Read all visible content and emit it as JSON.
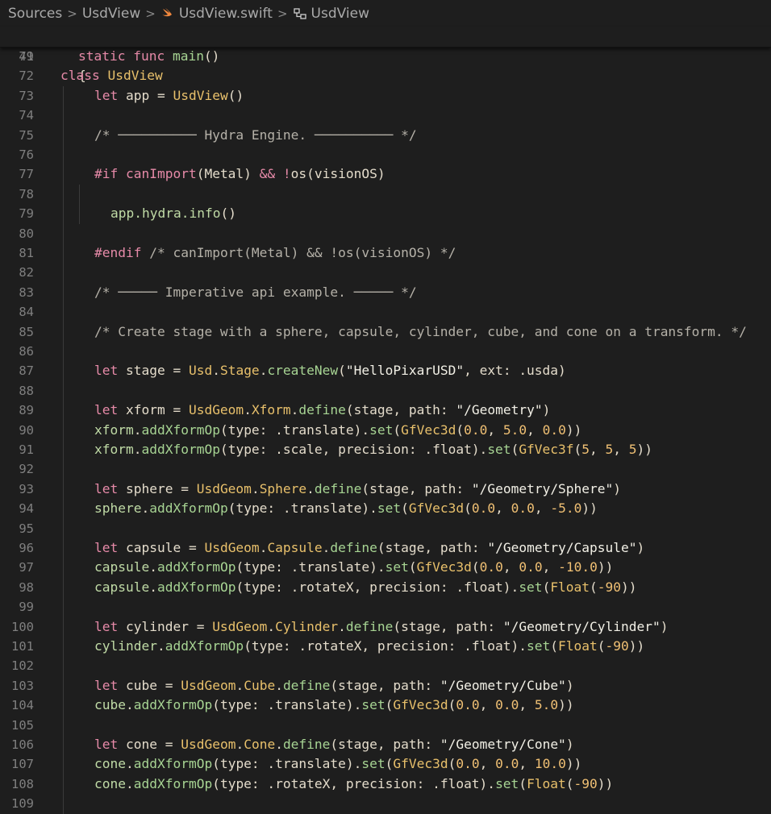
{
  "breadcrumb": {
    "items": [
      "Sources",
      "UsdView",
      "UsdView.swift",
      "UsdView"
    ]
  },
  "sticky": {
    "line_number": "49",
    "code": [
      [
        "kw",
        "class "
      ],
      [
        "ty",
        "UsdView"
      ]
    ]
  },
  "lines": [
    {
      "n": "71",
      "indent": 1,
      "tokens": [
        [
          "kw",
          "static func "
        ],
        [
          "fn",
          "main"
        ],
        [
          "pl",
          "()"
        ]
      ]
    },
    {
      "n": "72",
      "indent": 1,
      "tokens": [
        [
          "pl",
          "{"
        ]
      ]
    },
    {
      "n": "73",
      "indent": 2,
      "tokens": [
        [
          "kw",
          "let "
        ],
        [
          "pl",
          "app = "
        ],
        [
          "ty",
          "UsdView"
        ],
        [
          "pl",
          "()"
        ]
      ]
    },
    {
      "n": "74",
      "indent": 2,
      "tokens": []
    },
    {
      "n": "75",
      "indent": 2,
      "tokens": [
        [
          "cm",
          "/* ────────── Hydra Engine. ────────── */"
        ]
      ]
    },
    {
      "n": "76",
      "indent": 2,
      "tokens": []
    },
    {
      "n": "77",
      "indent": 2,
      "tokens": [
        [
          "pp",
          "#if "
        ],
        [
          "pp",
          "canImport"
        ],
        [
          "pl",
          "(Metal) "
        ],
        [
          "kw",
          "&& !"
        ],
        [
          "pl",
          "os(visionOS)"
        ]
      ]
    },
    {
      "n": "78",
      "indent": 3,
      "tokens": []
    },
    {
      "n": "79",
      "indent": 3,
      "tokens": [
        [
          "ac",
          "app.hydra.info"
        ],
        [
          "pl",
          "()"
        ]
      ]
    },
    {
      "n": "80",
      "indent": 2,
      "tokens": []
    },
    {
      "n": "81",
      "indent": 2,
      "tokens": [
        [
          "pp",
          "#endif "
        ],
        [
          "cm",
          "/* canImport(Metal) && !os(visionOS) */"
        ]
      ]
    },
    {
      "n": "82",
      "indent": 2,
      "tokens": []
    },
    {
      "n": "83",
      "indent": 2,
      "tokens": [
        [
          "cm",
          "/* ───── Imperative api example. ───── */"
        ]
      ]
    },
    {
      "n": "84",
      "indent": 2,
      "tokens": []
    },
    {
      "n": "85",
      "indent": 2,
      "tokens": [
        [
          "cm",
          "/* Create stage with a sphere, capsule, cylinder, cube, and cone on a transform. */"
        ]
      ]
    },
    {
      "n": "86",
      "indent": 2,
      "tokens": []
    },
    {
      "n": "87",
      "indent": 2,
      "tokens": [
        [
          "kw",
          "let "
        ],
        [
          "pl",
          "stage = "
        ],
        [
          "ty",
          "Usd"
        ],
        [
          "pl",
          "."
        ],
        [
          "ty",
          "Stage"
        ],
        [
          "pl",
          "."
        ],
        [
          "fn",
          "createNew"
        ],
        [
          "pl",
          "("
        ],
        [
          "str",
          "\"HelloPixarUSD\""
        ],
        [
          "pl",
          ", ext: .usda)"
        ]
      ]
    },
    {
      "n": "88",
      "indent": 2,
      "tokens": []
    },
    {
      "n": "89",
      "indent": 2,
      "tokens": [
        [
          "kw",
          "let "
        ],
        [
          "pl",
          "xform = "
        ],
        [
          "ty",
          "UsdGeom"
        ],
        [
          "pl",
          "."
        ],
        [
          "ty",
          "Xform"
        ],
        [
          "pl",
          "."
        ],
        [
          "fn",
          "define"
        ],
        [
          "pl",
          "(stage, path: "
        ],
        [
          "str",
          "\"/Geometry\""
        ],
        [
          "pl",
          ")"
        ]
      ]
    },
    {
      "n": "90",
      "indent": 2,
      "tokens": [
        [
          "ac",
          "xform"
        ],
        [
          "pl",
          "."
        ],
        [
          "fn",
          "addXformOp"
        ],
        [
          "pl",
          "(type: .translate)."
        ],
        [
          "fn",
          "set"
        ],
        [
          "pl",
          "("
        ],
        [
          "ty",
          "GfVec3d"
        ],
        [
          "pl",
          "("
        ],
        [
          "num",
          "0.0"
        ],
        [
          "pl",
          ", "
        ],
        [
          "num",
          "5.0"
        ],
        [
          "pl",
          ", "
        ],
        [
          "num",
          "0.0"
        ],
        [
          "pl",
          "))"
        ]
      ]
    },
    {
      "n": "91",
      "indent": 2,
      "tokens": [
        [
          "ac",
          "xform"
        ],
        [
          "pl",
          "."
        ],
        [
          "fn",
          "addXformOp"
        ],
        [
          "pl",
          "(type: .scale, precision: .float)."
        ],
        [
          "fn",
          "set"
        ],
        [
          "pl",
          "("
        ],
        [
          "ty",
          "GfVec3f"
        ],
        [
          "pl",
          "("
        ],
        [
          "num",
          "5"
        ],
        [
          "pl",
          ", "
        ],
        [
          "num",
          "5"
        ],
        [
          "pl",
          ", "
        ],
        [
          "num",
          "5"
        ],
        [
          "pl",
          "))"
        ]
      ]
    },
    {
      "n": "92",
      "indent": 2,
      "tokens": []
    },
    {
      "n": "93",
      "indent": 2,
      "tokens": [
        [
          "kw",
          "let "
        ],
        [
          "pl",
          "sphere = "
        ],
        [
          "ty",
          "UsdGeom"
        ],
        [
          "pl",
          "."
        ],
        [
          "ty",
          "Sphere"
        ],
        [
          "pl",
          "."
        ],
        [
          "fn",
          "define"
        ],
        [
          "pl",
          "(stage, path: "
        ],
        [
          "str",
          "\"/Geometry/Sphere\""
        ],
        [
          "pl",
          ")"
        ]
      ]
    },
    {
      "n": "94",
      "indent": 2,
      "tokens": [
        [
          "ac",
          "sphere"
        ],
        [
          "pl",
          "."
        ],
        [
          "fn",
          "addXformOp"
        ],
        [
          "pl",
          "(type: .translate)."
        ],
        [
          "fn",
          "set"
        ],
        [
          "pl",
          "("
        ],
        [
          "ty",
          "GfVec3d"
        ],
        [
          "pl",
          "("
        ],
        [
          "num",
          "0.0"
        ],
        [
          "pl",
          ", "
        ],
        [
          "num",
          "0.0"
        ],
        [
          "pl",
          ", "
        ],
        [
          "num",
          "-5.0"
        ],
        [
          "pl",
          "))"
        ]
      ]
    },
    {
      "n": "95",
      "indent": 2,
      "tokens": []
    },
    {
      "n": "96",
      "indent": 2,
      "tokens": [
        [
          "kw",
          "let "
        ],
        [
          "pl",
          "capsule = "
        ],
        [
          "ty",
          "UsdGeom"
        ],
        [
          "pl",
          "."
        ],
        [
          "ty",
          "Capsule"
        ],
        [
          "pl",
          "."
        ],
        [
          "fn",
          "define"
        ],
        [
          "pl",
          "(stage, path: "
        ],
        [
          "str",
          "\"/Geometry/Capsule\""
        ],
        [
          "pl",
          ")"
        ]
      ]
    },
    {
      "n": "97",
      "indent": 2,
      "tokens": [
        [
          "ac",
          "capsule"
        ],
        [
          "pl",
          "."
        ],
        [
          "fn",
          "addXformOp"
        ],
        [
          "pl",
          "(type: .translate)."
        ],
        [
          "fn",
          "set"
        ],
        [
          "pl",
          "("
        ],
        [
          "ty",
          "GfVec3d"
        ],
        [
          "pl",
          "("
        ],
        [
          "num",
          "0.0"
        ],
        [
          "pl",
          ", "
        ],
        [
          "num",
          "0.0"
        ],
        [
          "pl",
          ", "
        ],
        [
          "num",
          "-10.0"
        ],
        [
          "pl",
          "))"
        ]
      ]
    },
    {
      "n": "98",
      "indent": 2,
      "tokens": [
        [
          "ac",
          "capsule"
        ],
        [
          "pl",
          "."
        ],
        [
          "fn",
          "addXformOp"
        ],
        [
          "pl",
          "(type: .rotateX, precision: .float)."
        ],
        [
          "fn",
          "set"
        ],
        [
          "pl",
          "("
        ],
        [
          "ty",
          "Float"
        ],
        [
          "pl",
          "("
        ],
        [
          "num",
          "-90"
        ],
        [
          "pl",
          "))"
        ]
      ]
    },
    {
      "n": "99",
      "indent": 2,
      "tokens": []
    },
    {
      "n": "100",
      "indent": 2,
      "tokens": [
        [
          "kw",
          "let "
        ],
        [
          "pl",
          "cylinder = "
        ],
        [
          "ty",
          "UsdGeom"
        ],
        [
          "pl",
          "."
        ],
        [
          "ty",
          "Cylinder"
        ],
        [
          "pl",
          "."
        ],
        [
          "fn",
          "define"
        ],
        [
          "pl",
          "(stage, path: "
        ],
        [
          "str",
          "\"/Geometry/Cylinder\""
        ],
        [
          "pl",
          ")"
        ]
      ]
    },
    {
      "n": "101",
      "indent": 2,
      "tokens": [
        [
          "ac",
          "cylinder"
        ],
        [
          "pl",
          "."
        ],
        [
          "fn",
          "addXformOp"
        ],
        [
          "pl",
          "(type: .rotateX, precision: .float)."
        ],
        [
          "fn",
          "set"
        ],
        [
          "pl",
          "("
        ],
        [
          "ty",
          "Float"
        ],
        [
          "pl",
          "("
        ],
        [
          "num",
          "-90"
        ],
        [
          "pl",
          "))"
        ]
      ]
    },
    {
      "n": "102",
      "indent": 2,
      "tokens": []
    },
    {
      "n": "103",
      "indent": 2,
      "tokens": [
        [
          "kw",
          "let "
        ],
        [
          "pl",
          "cube = "
        ],
        [
          "ty",
          "UsdGeom"
        ],
        [
          "pl",
          "."
        ],
        [
          "ty",
          "Cube"
        ],
        [
          "pl",
          "."
        ],
        [
          "fn",
          "define"
        ],
        [
          "pl",
          "(stage, path: "
        ],
        [
          "str",
          "\"/Geometry/Cube\""
        ],
        [
          "pl",
          ")"
        ]
      ]
    },
    {
      "n": "104",
      "indent": 2,
      "tokens": [
        [
          "ac",
          "cube"
        ],
        [
          "pl",
          "."
        ],
        [
          "fn",
          "addXformOp"
        ],
        [
          "pl",
          "(type: .translate)."
        ],
        [
          "fn",
          "set"
        ],
        [
          "pl",
          "("
        ],
        [
          "ty",
          "GfVec3d"
        ],
        [
          "pl",
          "("
        ],
        [
          "num",
          "0.0"
        ],
        [
          "pl",
          ", "
        ],
        [
          "num",
          "0.0"
        ],
        [
          "pl",
          ", "
        ],
        [
          "num",
          "5.0"
        ],
        [
          "pl",
          "))"
        ]
      ]
    },
    {
      "n": "105",
      "indent": 2,
      "tokens": []
    },
    {
      "n": "106",
      "indent": 2,
      "tokens": [
        [
          "kw",
          "let "
        ],
        [
          "pl",
          "cone = "
        ],
        [
          "ty",
          "UsdGeom"
        ],
        [
          "pl",
          "."
        ],
        [
          "ty",
          "Cone"
        ],
        [
          "pl",
          "."
        ],
        [
          "fn",
          "define"
        ],
        [
          "pl",
          "(stage, path: "
        ],
        [
          "str",
          "\"/Geometry/Cone\""
        ],
        [
          "pl",
          ")"
        ]
      ]
    },
    {
      "n": "107",
      "indent": 2,
      "tokens": [
        [
          "ac",
          "cone"
        ],
        [
          "pl",
          "."
        ],
        [
          "fn",
          "addXformOp"
        ],
        [
          "pl",
          "(type: .translate)."
        ],
        [
          "fn",
          "set"
        ],
        [
          "pl",
          "("
        ],
        [
          "ty",
          "GfVec3d"
        ],
        [
          "pl",
          "("
        ],
        [
          "num",
          "0.0"
        ],
        [
          "pl",
          ", "
        ],
        [
          "num",
          "0.0"
        ],
        [
          "pl",
          ", "
        ],
        [
          "num",
          "10.0"
        ],
        [
          "pl",
          "))"
        ]
      ]
    },
    {
      "n": "108",
      "indent": 2,
      "tokens": [
        [
          "ac",
          "cone"
        ],
        [
          "pl",
          "."
        ],
        [
          "fn",
          "addXformOp"
        ],
        [
          "pl",
          "(type: .rotateX, precision: .float)."
        ],
        [
          "fn",
          "set"
        ],
        [
          "pl",
          "("
        ],
        [
          "ty",
          "Float"
        ],
        [
          "pl",
          "("
        ],
        [
          "num",
          "-90"
        ],
        [
          "pl",
          "))"
        ]
      ]
    },
    {
      "n": "109",
      "indent": 2,
      "tokens": []
    }
  ]
}
